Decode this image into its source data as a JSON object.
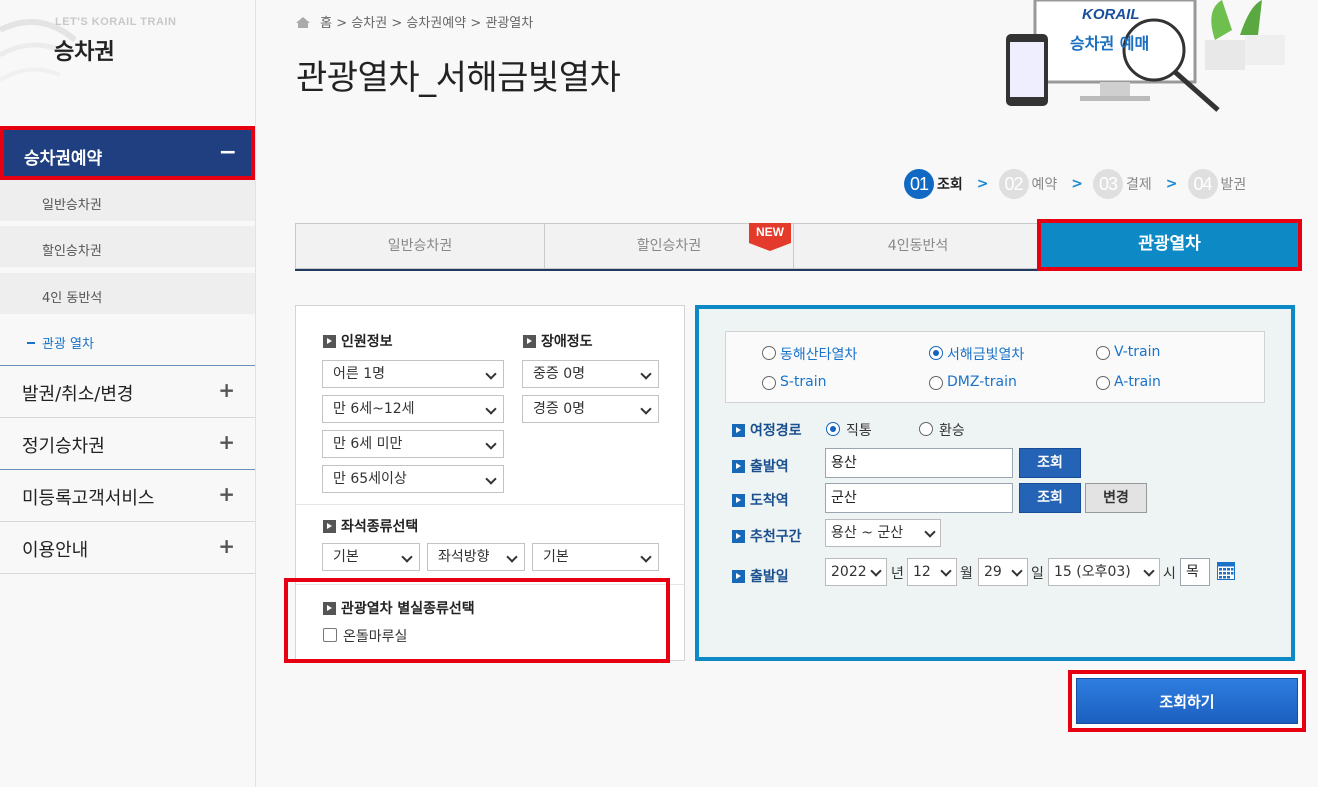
{
  "sidebar": {
    "brand": "LET'S KORAIL TRAIN",
    "title": "승차권",
    "active_section": {
      "label": "승차권예약",
      "toggle": "−"
    },
    "sub_items": [
      {
        "label": "일반승차권"
      },
      {
        "label": "할인승차권"
      },
      {
        "label": "4인 동반석"
      }
    ],
    "current_item": {
      "label": "관광 열차"
    },
    "main_items": [
      {
        "label": "발권/취소/변경",
        "toggle": "+"
      },
      {
        "label": "정기승차권",
        "toggle": "+"
      },
      {
        "label": "미등록고객서비스",
        "toggle": "+"
      },
      {
        "label": "이용안내",
        "toggle": "+"
      }
    ]
  },
  "breadcrumb": [
    "홈",
    "승차권",
    "승차권예약",
    "관광열차"
  ],
  "breadcrumb_sep": ">",
  "page_title": "관광열차_서해금빛열차",
  "hero": {
    "logo": "KORAIL",
    "caption": "승차권 예매"
  },
  "steps": [
    {
      "num": "01",
      "label": "조회",
      "active": true
    },
    {
      "num": "02",
      "label": "예약",
      "active": false
    },
    {
      "num": "03",
      "label": "결제",
      "active": false
    },
    {
      "num": "04",
      "label": "발권",
      "active": false
    }
  ],
  "tabs": [
    {
      "label": "일반승차권"
    },
    {
      "label": "할인승차권"
    },
    {
      "label": "4인동반석"
    },
    {
      "label": "관광열차"
    }
  ],
  "new_badge": "NEW",
  "passengers": {
    "heading": "인원정보",
    "selects": [
      "어른 1명",
      "만 6세~12세",
      "만 6세 미만",
      "만 65세이상"
    ]
  },
  "disability": {
    "heading": "장애정도",
    "selects": [
      "중증 0명",
      "경증 0명"
    ]
  },
  "seat_type": {
    "heading": "좌석종류선택",
    "selects": [
      "기본",
      "좌석방향",
      "기본"
    ]
  },
  "special_room": {
    "heading": "관광열차 별실종류선택",
    "checkbox_label": "온돌마루실",
    "checked": false
  },
  "trains": [
    {
      "label": "동해산타열차",
      "checked": false
    },
    {
      "label": "서해금빛열차",
      "checked": true
    },
    {
      "label": "V-train",
      "checked": false
    },
    {
      "label": "S-train",
      "checked": false
    },
    {
      "label": "DMZ-train",
      "checked": false
    },
    {
      "label": "A-train",
      "checked": false
    }
  ],
  "route": {
    "heading": "여정경로",
    "options": [
      {
        "label": "직통",
        "checked": true
      },
      {
        "label": "환승",
        "checked": false
      }
    ]
  },
  "departure": {
    "heading": "출발역",
    "value": "용산",
    "button": "조회"
  },
  "arrival": {
    "heading": "도착역",
    "value": "군산",
    "button": "조회",
    "swap_button": "변경"
  },
  "recommend": {
    "heading": "추천구간",
    "value": "용산 ~ 군산"
  },
  "date": {
    "heading": "출발일",
    "year": "2022",
    "year_unit": "년",
    "month": "12",
    "month_unit": "월",
    "day": "29",
    "day_unit": "일",
    "hour": "15 (오후03)",
    "hour_unit": "시",
    "weekday": "목",
    "calendar_icon": "calendar-icon"
  },
  "search_button": "조회하기",
  "colors": {
    "accent": "#0d89c6",
    "highlight": "#e60012",
    "sidebar_active": "#1f3f80",
    "button": "#2463b5"
  }
}
